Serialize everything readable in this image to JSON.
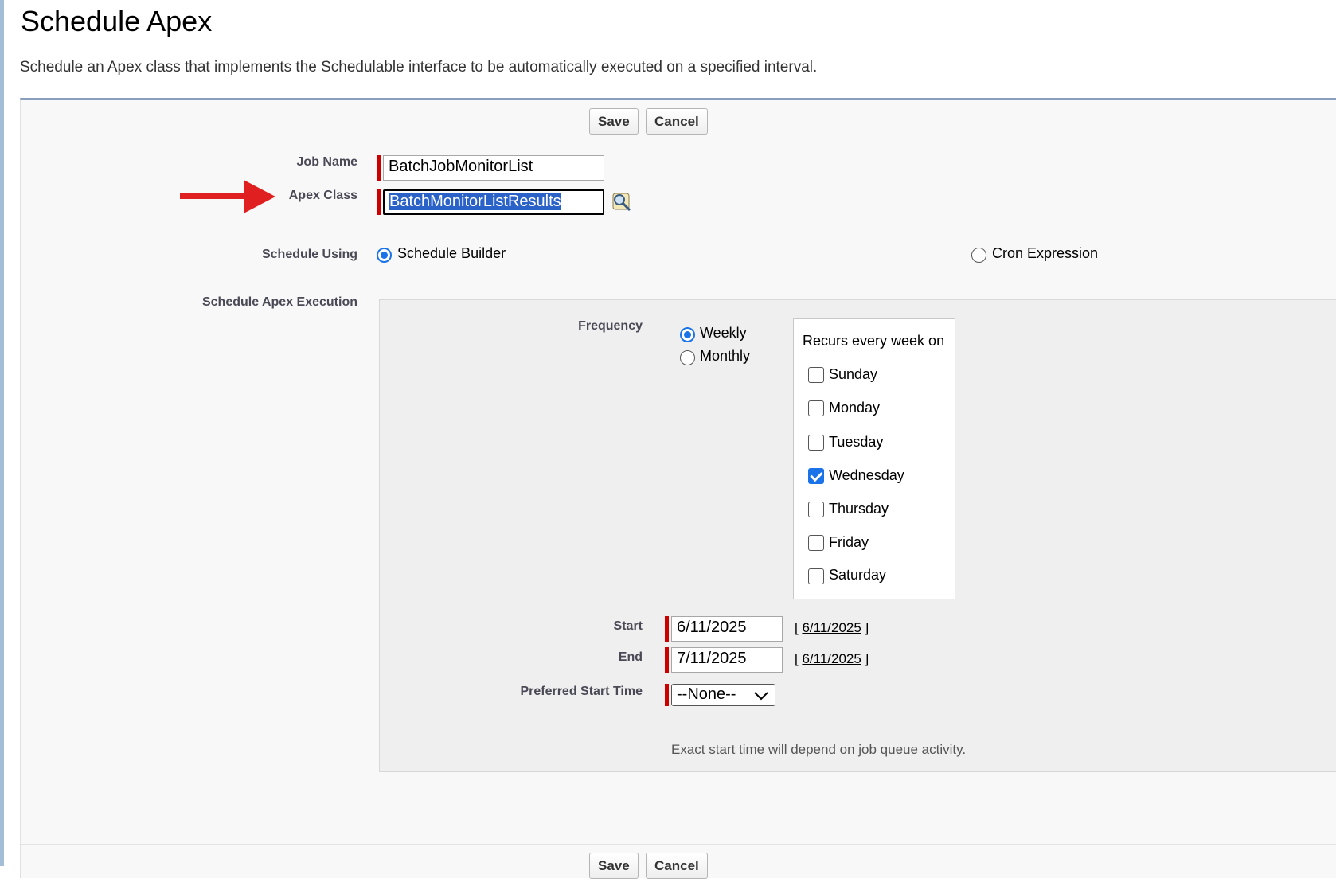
{
  "page": {
    "title": "Schedule Apex",
    "description": "Schedule an Apex class that implements the Schedulable interface to be automatically executed on a specified interval."
  },
  "toolbar": {
    "save_label": "Save",
    "cancel_label": "Cancel"
  },
  "form": {
    "job_name_label": "Job Name",
    "job_name_value": "BatchJobMonitorList",
    "apex_class_label": "Apex Class",
    "apex_class_value": "BatchMonitorListResults",
    "schedule_using_label": "Schedule Using",
    "schedule_options": [
      "Schedule Builder",
      "Cron Expression"
    ],
    "schedule_selected": "Schedule Builder",
    "execution_label": "Schedule Apex Execution"
  },
  "execution": {
    "frequency_label": "Frequency",
    "frequency_options": [
      "Weekly",
      "Monthly"
    ],
    "frequency_selected": "Weekly",
    "recurs_label": "Recurs every week on",
    "days": [
      {
        "name": "Sunday",
        "checked": false
      },
      {
        "name": "Monday",
        "checked": false
      },
      {
        "name": "Tuesday",
        "checked": false
      },
      {
        "name": "Wednesday",
        "checked": true
      },
      {
        "name": "Thursday",
        "checked": false
      },
      {
        "name": "Friday",
        "checked": false
      },
      {
        "name": "Saturday",
        "checked": false
      }
    ],
    "start_label": "Start",
    "start_value": "6/11/2025",
    "start_today_link": "6/11/2025",
    "end_label": "End",
    "end_value": "7/11/2025",
    "end_today_link": "6/11/2025",
    "preferred_time_label": "Preferred Start Time",
    "preferred_time_value": "--None--",
    "note": "Exact start time will depend on job queue activity."
  },
  "colors": {
    "required": "#cc0000",
    "accent": "#1a73e8",
    "arrow": "#e02020"
  }
}
